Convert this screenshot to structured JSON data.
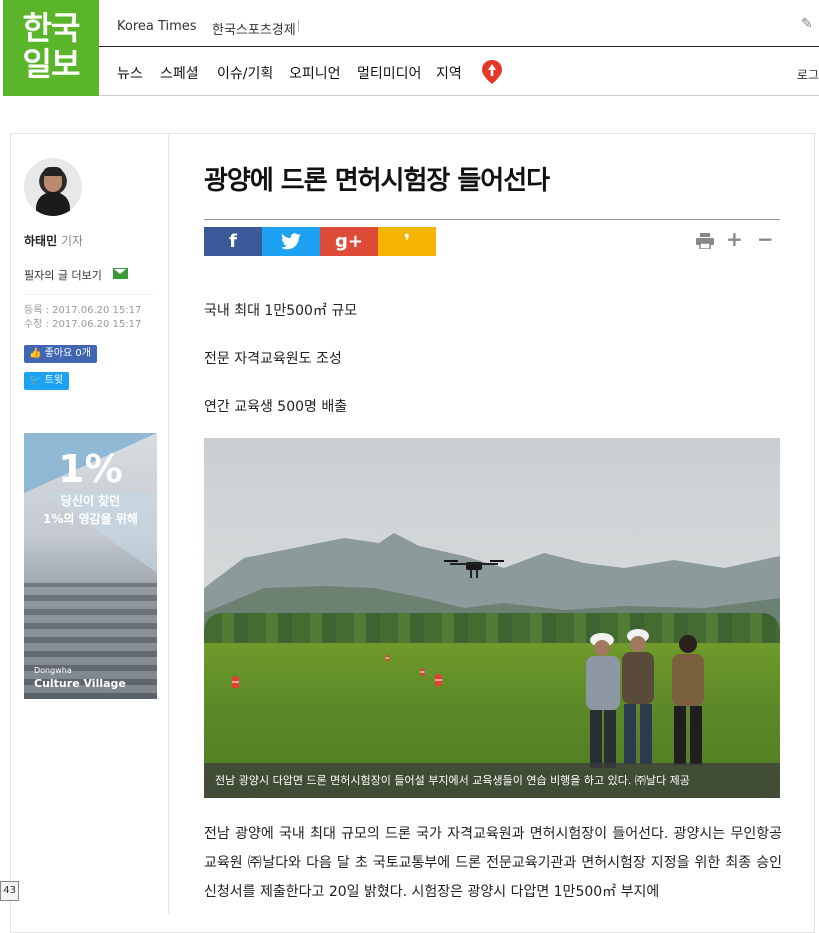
{
  "header": {
    "logo_line1": "한국",
    "logo_line2": "일보",
    "sites": [
      "Korea Times",
      "한국스포츠경제"
    ],
    "nav": [
      "뉴스",
      "스페셜",
      "이슈/기획",
      "오피니언",
      "멀티미디어",
      "지역"
    ],
    "login": "로그"
  },
  "sidebar": {
    "reporter_name": "하태민",
    "reporter_role": "기자",
    "more_articles": "필자의 글 더보기",
    "registered": "등록 : 2017.06.20 15:17",
    "modified": "수정 : 2017.06.20 15:17",
    "like_label": "좋아요 0개",
    "tweet_label": "트윗",
    "ad": {
      "headline": "1%",
      "line1": "당신이 찾던",
      "line2": "1%의 영감을 위해",
      "brand_small": "Dongwha",
      "brand_main": "Culture Village"
    }
  },
  "article": {
    "title": "광양에 드론 면허시험장 들어선다",
    "share": {
      "facebook": "f",
      "twitter": "t",
      "googleplus": "g+",
      "kakao": "❜",
      "colors": {
        "facebook": "#3b5998",
        "twitter": "#1da1f2",
        "googleplus": "#dd4b39",
        "kakao": "#f5b400"
      }
    },
    "tools": {
      "print": "print-icon",
      "zoom_in": "+",
      "zoom_out": "−"
    },
    "subheads": [
      "국내 최대 1만500㎡ 규모",
      "전문 자격교육원도 조성",
      "연간 교육생 500명 배출"
    ],
    "photo_caption": "전남 광양시 다압면 드론 면허시험장이 들어설 부지에서 교육생들이 연습 비행을 하고 있다. ㈜날다 제공",
    "body": "전남 광양에 국내 최대 규모의 드론 국가 자격교육원과 면허시험장이 들어선다. 광양시는 무인항공교육원 ㈜날다와 다음 달 초 국토교통부에 드론 전문교육기관과 면허시험장 지정을 위한 최종 승인신청서를 제출한다고 20일 밝혔다. 시험장은 광양시 다압면 1만500㎡ 부지에"
  },
  "page_badge": "43",
  "brand_green": "#5bb52b"
}
